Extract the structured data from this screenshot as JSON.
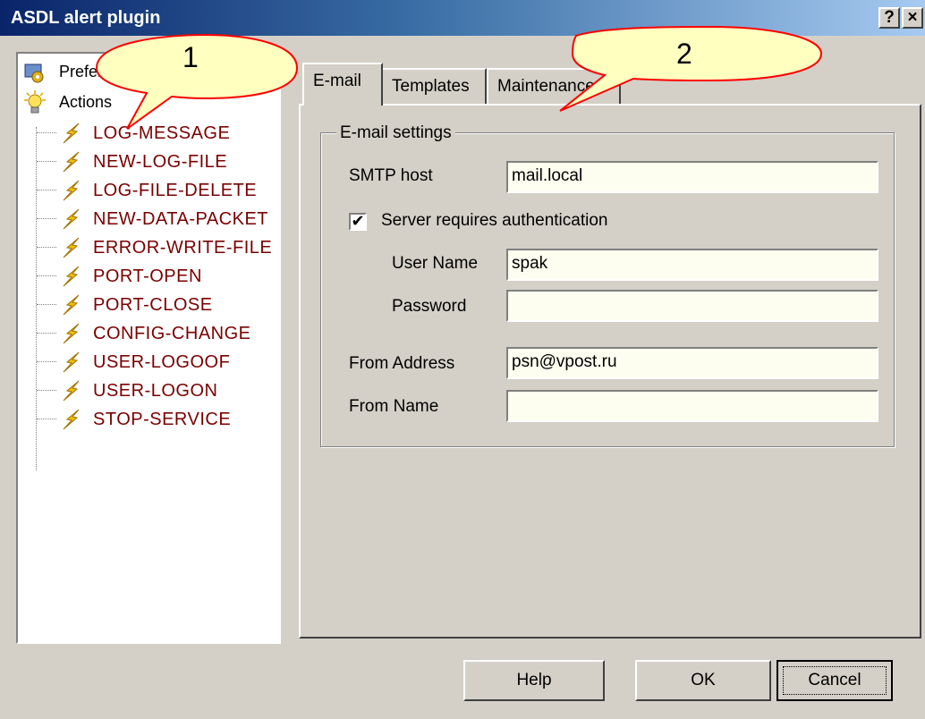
{
  "window": {
    "title": "ASDL alert plugin",
    "help_glyph": "?",
    "close_glyph": "×"
  },
  "tree": {
    "root_items": [
      {
        "label": "Preferences",
        "icon": "settings-icon"
      },
      {
        "label": "Actions",
        "icon": "lightbulb-icon"
      }
    ],
    "actions": [
      "LOG-MESSAGE",
      "NEW-LOG-FILE",
      "LOG-FILE-DELETE",
      "NEW-DATA-PACKET",
      "ERROR-WRITE-FILE",
      "PORT-OPEN",
      "PORT-CLOSE",
      "CONFIG-CHANGE",
      "USER-LOGOOF",
      "USER-LOGON",
      "STOP-SERVICE"
    ],
    "action_icon": "lightning-bolt-icon"
  },
  "tabs": [
    {
      "label": "E-mail",
      "active": true
    },
    {
      "label": "Templates",
      "active": false
    },
    {
      "label": "Maintenance",
      "active": false
    }
  ],
  "email_settings": {
    "group_title": "E-mail settings",
    "smtp_host_label": "SMTP host",
    "smtp_host_value": "mail.local",
    "auth_checkbox_label": "Server requires authentication",
    "auth_checked": true,
    "check_glyph": "✔",
    "user_name_label": "User Name",
    "user_name_value": "spak",
    "password_label": "Password",
    "password_value": "",
    "from_address_label": "From Address",
    "from_address_value": "psn@vpost.ru",
    "from_name_label": "From Name",
    "from_name_value": ""
  },
  "buttons": {
    "help": "Help",
    "ok": "OK",
    "cancel": "Cancel"
  },
  "callouts": [
    {
      "number": "1"
    },
    {
      "number": "2"
    }
  ],
  "colors": {
    "titlebar_start": "#0a246a",
    "action_label": "#7a0000",
    "field_bg": "#fdfdf0",
    "face": "#d4d0c8"
  }
}
